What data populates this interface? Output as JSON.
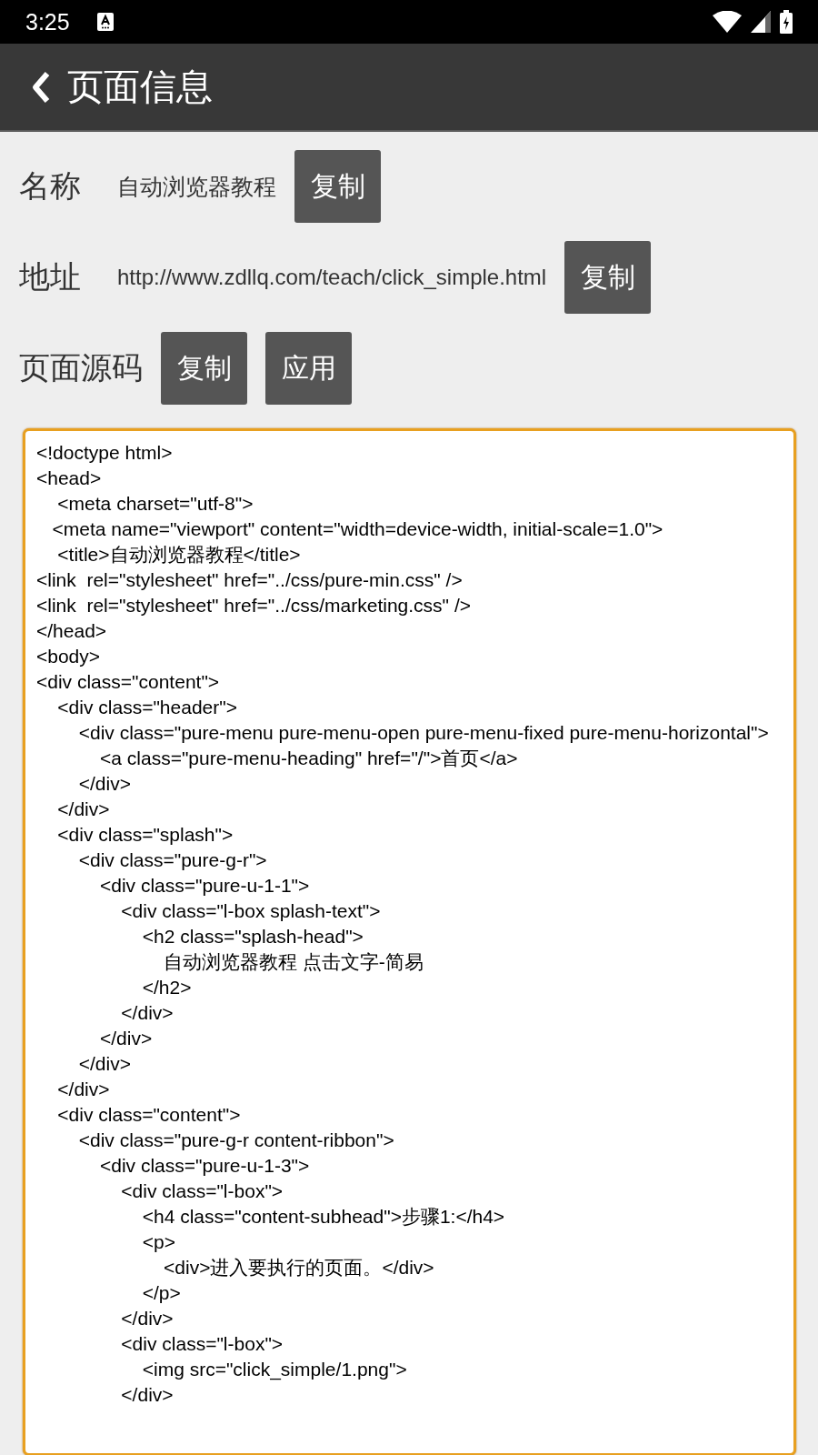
{
  "status_bar": {
    "time": "3:25"
  },
  "app_bar": {
    "title": "页面信息"
  },
  "fields": [
    {
      "label": "名称",
      "value": "自动浏览器教程",
      "buttons": [
        "复制"
      ]
    },
    {
      "label": "地址",
      "value": "http://www.zdllq.com/teach/click_simple.html",
      "buttons": [
        "复制"
      ]
    },
    {
      "label": "页面源码",
      "buttons": [
        "复制",
        "应用"
      ]
    }
  ],
  "source": {
    "focused": true,
    "text": "<!doctype html>\n<head>\n    <meta charset=\"utf-8\">\n   <meta name=\"viewport\" content=\"width=device-width, initial-scale=1.0\">\n    <title>自动浏览器教程</title>\n<link  rel=\"stylesheet\" href=\"../css/pure-min.css\" />\n<link  rel=\"stylesheet\" href=\"../css/marketing.css\" />\n</head>\n<body>\n<div class=\"content\">\n    <div class=\"header\">\n        <div class=\"pure-menu pure-menu-open pure-menu-fixed pure-menu-horizontal\">\n            <a class=\"pure-menu-heading\" href=\"/\">首页</a>\n        </div>\n    </div>\n    <div class=\"splash\">\n        <div class=\"pure-g-r\">\n            <div class=\"pure-u-1-1\">\n                <div class=\"l-box splash-text\">\n                    <h2 class=\"splash-head\">\n                        自动浏览器教程 点击文字-简易\n                    </h2>\n                </div>\n            </div>\n        </div>\n    </div>\n    <div class=\"content\">\n        <div class=\"pure-g-r content-ribbon\">\n            <div class=\"pure-u-1-3\">\n                <div class=\"l-box\">\n                    <h4 class=\"content-subhead\">步骤1:</h4>\n                    <p>\n                        <div>进入要执行的页面。</div>\n                    </p>\n                </div>\n                <div class=\"l-box\">\n                    <img src=\"click_simple/1.png\">\n                </div>"
  }
}
